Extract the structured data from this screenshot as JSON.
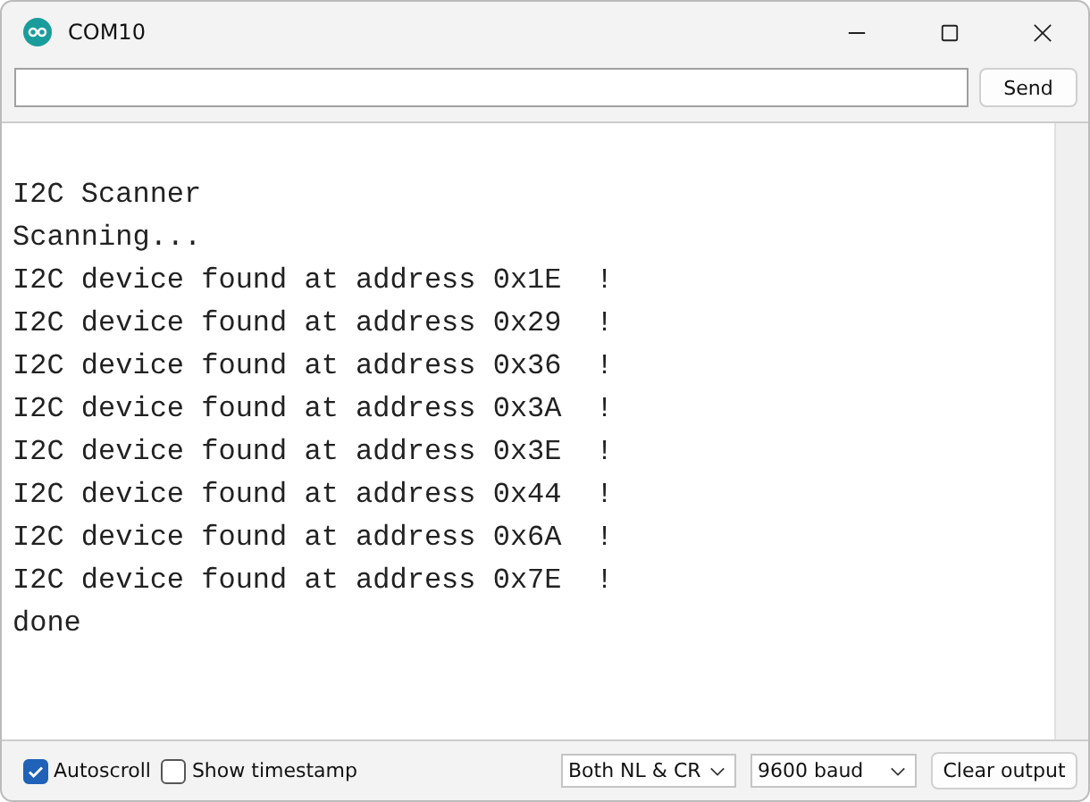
{
  "window": {
    "title": "COM10"
  },
  "send_button": "Send",
  "output_lines": [
    "I2C Scanner",
    "Scanning...",
    "I2C device found at address 0x1E  !",
    "I2C device found at address 0x29  !",
    "I2C device found at address 0x36  !",
    "I2C device found at address 0x3A  !",
    "I2C device found at address 0x3E  !",
    "I2C device found at address 0x44  !",
    "I2C device found at address 0x6A  !",
    "I2C device found at address 0x7E  !",
    "done"
  ],
  "options": [
    {
      "label": "Autoscroll",
      "checked": true
    },
    {
      "label": "Show timestamp",
      "checked": false
    }
  ],
  "dropdowns": [
    "Both NL & CR",
    "9600 baud"
  ],
  "clear_button": "Clear output"
}
